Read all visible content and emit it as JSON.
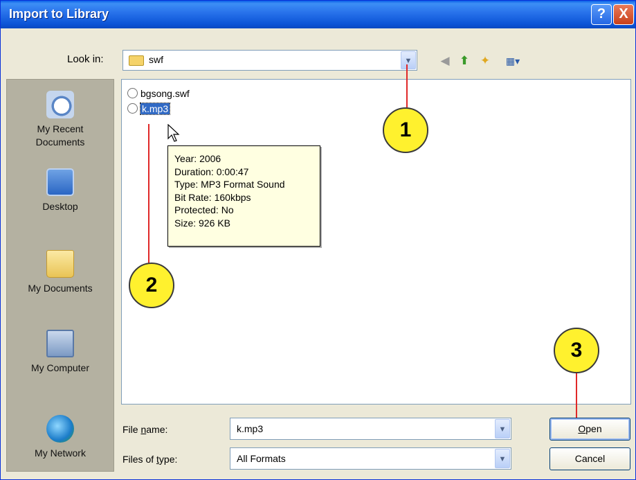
{
  "window": {
    "title": "Import to Library",
    "help_button": "?",
    "close_button": "X"
  },
  "look_in": {
    "label": "Look in:",
    "value": "swf"
  },
  "toolbar": {
    "back_icon": "◀",
    "up_icon": "⬆",
    "new_folder_icon": "✦",
    "views_icon": "▦▾"
  },
  "places": [
    {
      "label": "My Recent\nDocuments",
      "icon": "recent-documents-icon"
    },
    {
      "label": "Desktop",
      "icon": "desktop-icon"
    },
    {
      "label": "My Documents",
      "icon": "my-documents-icon"
    },
    {
      "label": "My Computer",
      "icon": "my-computer-icon"
    },
    {
      "label": "My Network",
      "icon": "my-network-icon"
    }
  ],
  "files": [
    {
      "name": "bgsong.swf",
      "selected": false
    },
    {
      "name": "k.mp3",
      "selected": true
    }
  ],
  "tooltip": {
    "lines": [
      "Year: 2006",
      "Duration: 0:00:47",
      "Type: MP3 Format Sound",
      "Bit Rate: 160kbps",
      "Protected: No",
      "Size: 926 KB"
    ]
  },
  "callouts": [
    "1",
    "2",
    "3"
  ],
  "file_name": {
    "label_pre": "File ",
    "label_accel": "n",
    "label_post": "ame:",
    "value": "k.mp3"
  },
  "file_type": {
    "label_pre": "Files of ",
    "label_accel": "t",
    "label_post": "ype:",
    "value": "All Formats"
  },
  "buttons": {
    "open_accel": "O",
    "open_rest": "pen",
    "cancel": "Cancel"
  },
  "colors": {
    "titlebar": "#0a5fe8",
    "selection": "#316ac5",
    "callout_fill": "#fff12e",
    "callout_line": "#e02828",
    "tooltip_bg": "#ffffe1"
  }
}
